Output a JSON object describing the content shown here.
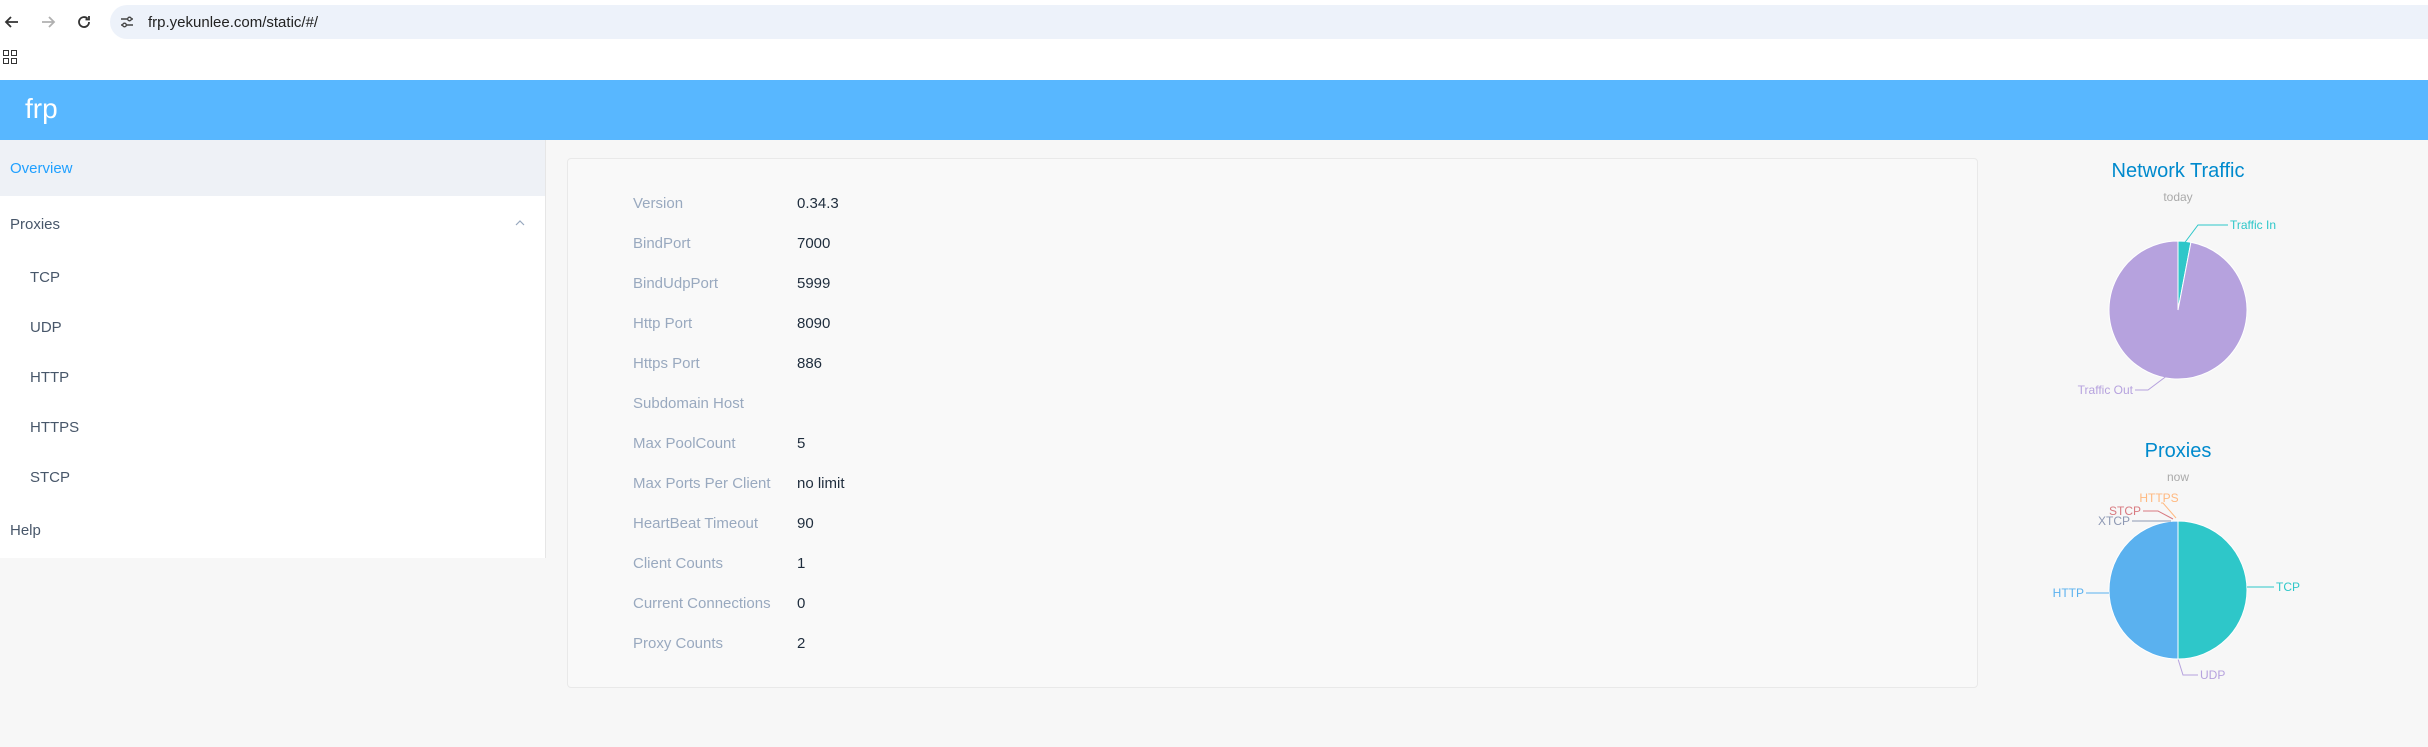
{
  "browser": {
    "url": "frp.yekunlee.com/static/#/"
  },
  "app": {
    "brand": "frp"
  },
  "sidebar": {
    "overview": "Overview",
    "proxies": "Proxies",
    "proxy_types": [
      "TCP",
      "UDP",
      "HTTP",
      "HTTPS",
      "STCP"
    ],
    "help": "Help"
  },
  "server_info": [
    {
      "label": "Version",
      "value": "0.34.3"
    },
    {
      "label": "BindPort",
      "value": "7000"
    },
    {
      "label": "BindUdpPort",
      "value": "5999"
    },
    {
      "label": "Http Port",
      "value": "8090"
    },
    {
      "label": "Https Port",
      "value": "886"
    },
    {
      "label": "Subdomain Host",
      "value": ""
    },
    {
      "label": "Max PoolCount",
      "value": "5"
    },
    {
      "label": "Max Ports Per Client",
      "value": "no limit"
    },
    {
      "label": "HeartBeat Timeout",
      "value": "90"
    },
    {
      "label": "Client Counts",
      "value": "1"
    },
    {
      "label": "Current Connections",
      "value": "0"
    },
    {
      "label": "Proxy Counts",
      "value": "2"
    }
  ],
  "traffic_chart": {
    "title": "Network Traffic",
    "subtitle": "today",
    "slices": [
      {
        "name": "Traffic In",
        "value": 3,
        "color": "#2ec7c9"
      },
      {
        "name": "Traffic Out",
        "value": 97,
        "color": "#b6a2de"
      }
    ]
  },
  "proxies_chart": {
    "title": "Proxies",
    "subtitle": "now",
    "slices": [
      {
        "name": "TCP",
        "value": 1,
        "color": "#2ec7c9"
      },
      {
        "name": "UDP",
        "value": 0,
        "color": "#b6a2de"
      },
      {
        "name": "HTTP",
        "value": 1,
        "color": "#5ab1ef"
      },
      {
        "name": "XTCP",
        "value": 0,
        "color": "#8d98b3"
      },
      {
        "name": "STCP",
        "value": 0,
        "color": "#d87a80"
      },
      {
        "name": "HTTPS",
        "value": 0,
        "color": "#ffb980"
      }
    ]
  }
}
